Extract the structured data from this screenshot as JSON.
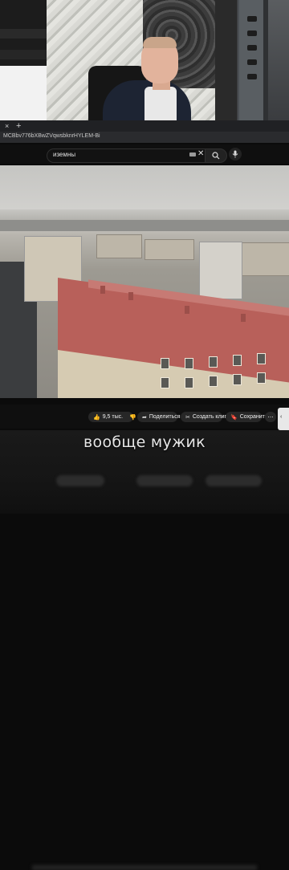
{
  "top_left_panel": {
    "text": ""
  },
  "browser": {
    "tab_close": "×",
    "tab_add": "+",
    "url": "MCBbv776bXBwZVqwsbknrHYLEM-Bi"
  },
  "youtube": {
    "search_query": "иземны",
    "clear_icon": "✕"
  },
  "actions": {
    "like_count": "9,5 тыс.",
    "share_label": "Поделиться",
    "clip_label": "Создать клип",
    "save_label": "Сохранить",
    "more_label": "⋯"
  },
  "subtitle": "вообще мужик",
  "colors": {
    "background": "#0f0f0f",
    "pill": "#272727",
    "roof": "#b8605a"
  }
}
